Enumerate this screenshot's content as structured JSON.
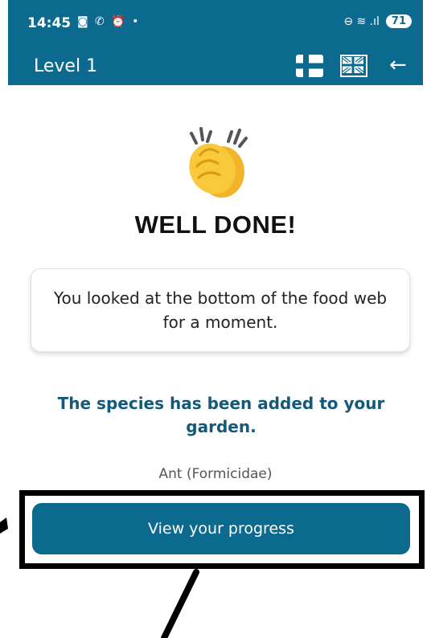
{
  "status_bar": {
    "time": "14:45",
    "icons_left": "◙ ✆ ⏰ •",
    "icons_right": "⊖ ≋ .ıl",
    "battery": "71"
  },
  "app_bar": {
    "title": "Level 1",
    "flags": [
      "finnish-flag-icon",
      "uk-flag-icon"
    ],
    "back_icon": "←"
  },
  "main": {
    "emoji": "clapping-hands-icon",
    "headline": "WELL DONE!",
    "message": "You looked at the bottom of the food web for a moment.",
    "added_text": "The species has been added to your garden.",
    "species": "Ant (Formicidae)",
    "button_label": "View your progress"
  },
  "colors": {
    "primary": "#0d6a8f",
    "text_teal": "#14587a"
  }
}
